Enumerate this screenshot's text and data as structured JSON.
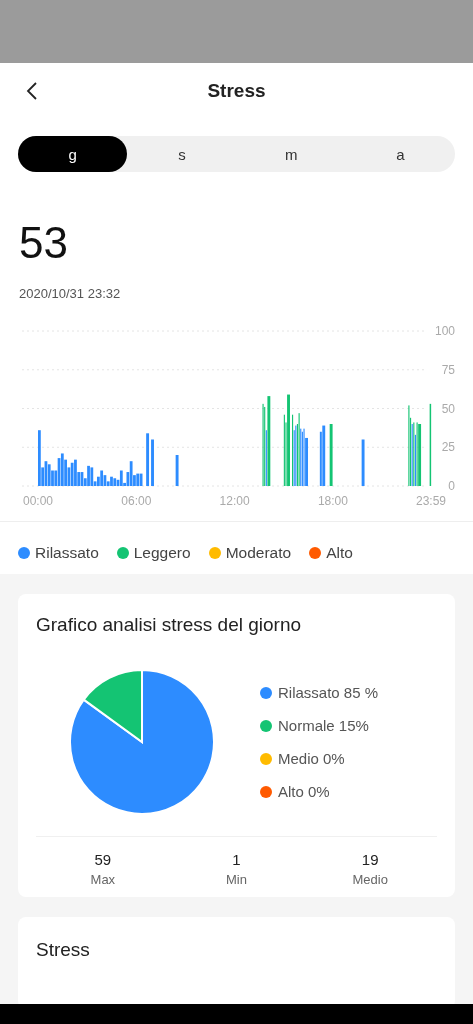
{
  "header": {
    "title": "Stress"
  },
  "periods": [
    {
      "label": "g",
      "selected": true
    },
    {
      "label": "s",
      "selected": false
    },
    {
      "label": "m",
      "selected": false
    },
    {
      "label": "a",
      "selected": false
    }
  ],
  "current": {
    "value": "53",
    "timestamp": "2020/10/31 23:32"
  },
  "day_chart": {
    "chart_data": {
      "type": "bar",
      "grid": true,
      "xlim": [
        0,
        23.983
      ],
      "ylim": [
        0,
        100
      ],
      "xticks": [
        {
          "value": 0,
          "label": "00:00"
        },
        {
          "value": 6,
          "label": "06:00"
        },
        {
          "value": 12,
          "label": "12:00"
        },
        {
          "value": 18,
          "label": "18:00"
        },
        {
          "value": 23.983,
          "label": "23:59"
        }
      ],
      "yticks": [
        0,
        25,
        50,
        75,
        100
      ],
      "x": [
        0,
        0.2,
        0.4,
        0.6,
        0.8,
        1.0,
        1.2,
        1.4,
        1.6,
        1.8,
        2.0,
        2.2,
        2.4,
        2.6,
        2.8,
        3.0,
        3.2,
        3.4,
        3.6,
        3.8,
        4.0,
        4.2,
        4.4,
        4.6,
        4.8,
        5.0,
        5.2,
        5.4,
        5.6,
        5.8,
        6.0,
        6.2,
        6.6,
        6.9,
        8.4,
        13.7,
        13.8,
        13.9,
        14.0,
        15.0,
        15.1,
        15.2,
        15.5,
        15.6,
        15.7,
        15.8,
        15.9,
        16.0,
        16.1,
        16.2,
        16.3,
        17.2,
        17.35,
        17.8,
        19.75,
        22.6,
        22.7,
        22.8,
        22.9,
        23.0,
        23.1,
        23.2,
        23.9
      ],
      "series": [
        {
          "color": "#2d8cff",
          "values": [
            36,
            12,
            16,
            14,
            10,
            10,
            18,
            21,
            17,
            12,
            15,
            17,
            9,
            9,
            5,
            13,
            12,
            3,
            6,
            10,
            7,
            3,
            6,
            5,
            4,
            10,
            2,
            9,
            16,
            7,
            8,
            8,
            34,
            30,
            20,
            null,
            null,
            36,
            null,
            null,
            null,
            null,
            null,
            36,
            39,
            null,
            null,
            37,
            35,
            37,
            31,
            35,
            39,
            null,
            30,
            null,
            null,
            40,
            null,
            33,
            null,
            null,
            null
          ]
        },
        {
          "color": "#14c473",
          "values": [
            null,
            null,
            null,
            null,
            null,
            null,
            null,
            null,
            null,
            null,
            null,
            null,
            null,
            null,
            null,
            null,
            null,
            null,
            null,
            null,
            null,
            null,
            null,
            null,
            null,
            null,
            null,
            null,
            null,
            null,
            null,
            null,
            null,
            null,
            null,
            53,
            51,
            null,
            58,
            46,
            41,
            59,
            46,
            null,
            null,
            40,
            47,
            null,
            null,
            null,
            null,
            null,
            null,
            40,
            null,
            52,
            44,
            null,
            41,
            null,
            41,
            40,
            53
          ]
        }
      ]
    },
    "legend": [
      {
        "label": "Rilassato",
        "color": "#2d8cff"
      },
      {
        "label": "Leggero",
        "color": "#14c473"
      },
      {
        "label": "Moderato",
        "color": "#ffbb00"
      },
      {
        "label": "Alto",
        "color": "#ff5a00"
      }
    ]
  },
  "analysis_card": {
    "title": "Grafico analisi stress del giorno",
    "chart_data": {
      "type": "pie",
      "values": [
        85,
        15
      ],
      "colors": [
        "#2d8cff",
        "#14c473"
      ]
    },
    "legend": [
      {
        "label": "Rilassato 85 %",
        "color": "#2d8cff"
      },
      {
        "label": "Normale 15%",
        "color": "#14c473"
      },
      {
        "label": "Medio 0%",
        "color": "#ffbb00"
      },
      {
        "label": "Alto 0%",
        "color": "#ff5a00"
      }
    ],
    "stats": [
      {
        "value": "59",
        "label": "Max"
      },
      {
        "value": "1",
        "label": "Min"
      },
      {
        "value": "19",
        "label": "Medio"
      }
    ]
  },
  "next_card": {
    "title": "Stress"
  }
}
